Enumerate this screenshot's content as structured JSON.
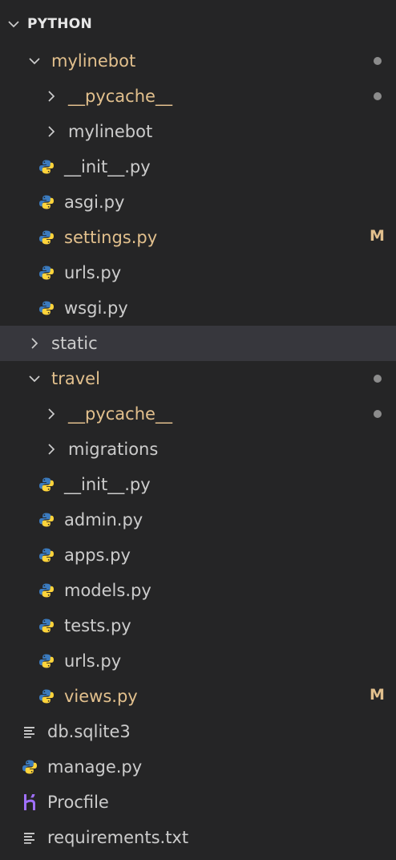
{
  "explorer": {
    "section_title": "PYTHON",
    "items": [
      {
        "label": "mylinebot",
        "kind": "folder",
        "expanded": true,
        "depth": 1,
        "modified": true,
        "decoration": "dot"
      },
      {
        "label": "__pycache__",
        "kind": "folder",
        "expanded": false,
        "depth": 2,
        "modified": true,
        "decoration": "dot"
      },
      {
        "label": "mylinebot",
        "kind": "folder",
        "expanded": false,
        "depth": 2,
        "modified": false
      },
      {
        "label": "__init__.py",
        "kind": "python",
        "depth": 2,
        "modified": false
      },
      {
        "label": "asgi.py",
        "kind": "python",
        "depth": 2,
        "modified": false
      },
      {
        "label": "settings.py",
        "kind": "python",
        "depth": 2,
        "modified": true,
        "badge": "M"
      },
      {
        "label": "urls.py",
        "kind": "python",
        "depth": 2,
        "modified": false
      },
      {
        "label": "wsgi.py",
        "kind": "python",
        "depth": 2,
        "modified": false
      },
      {
        "label": "static",
        "kind": "folder",
        "expanded": false,
        "depth": 1,
        "modified": false,
        "selected": true
      },
      {
        "label": "travel",
        "kind": "folder",
        "expanded": true,
        "depth": 1,
        "modified": true,
        "decoration": "dot"
      },
      {
        "label": "__pycache__",
        "kind": "folder",
        "expanded": false,
        "depth": 2,
        "modified": true,
        "decoration": "dot"
      },
      {
        "label": "migrations",
        "kind": "folder",
        "expanded": false,
        "depth": 2,
        "modified": false
      },
      {
        "label": "__init__.py",
        "kind": "python",
        "depth": 2,
        "modified": false
      },
      {
        "label": "admin.py",
        "kind": "python",
        "depth": 2,
        "modified": false
      },
      {
        "label": "apps.py",
        "kind": "python",
        "depth": 2,
        "modified": false
      },
      {
        "label": "models.py",
        "kind": "python",
        "depth": 2,
        "modified": false
      },
      {
        "label": "tests.py",
        "kind": "python",
        "depth": 2,
        "modified": false
      },
      {
        "label": "urls.py",
        "kind": "python",
        "depth": 2,
        "modified": false
      },
      {
        "label": "views.py",
        "kind": "python",
        "depth": 2,
        "modified": true,
        "badge": "M"
      },
      {
        "label": "db.sqlite3",
        "kind": "text",
        "depth": 1,
        "modified": false
      },
      {
        "label": "manage.py",
        "kind": "python",
        "depth": 1,
        "modified": false
      },
      {
        "label": "Procfile",
        "kind": "heroku",
        "depth": 1,
        "modified": false
      },
      {
        "label": "requirements.txt",
        "kind": "text",
        "depth": 1,
        "modified": false
      }
    ]
  },
  "icons": {
    "chevron_down": "chevron-down-icon",
    "chevron_right": "chevron-right-icon",
    "python": "python-file-icon",
    "text": "text-file-icon",
    "heroku": "heroku-icon"
  },
  "colors": {
    "background": "#252526",
    "text": "#cccccc",
    "modified": "#e2c08d",
    "selected_row": "#37373d",
    "dot": "#8c8c8c",
    "python_blue": "#3b7bbf",
    "python_yellow": "#ffd43b",
    "heroku_purple": "#a070ff"
  }
}
